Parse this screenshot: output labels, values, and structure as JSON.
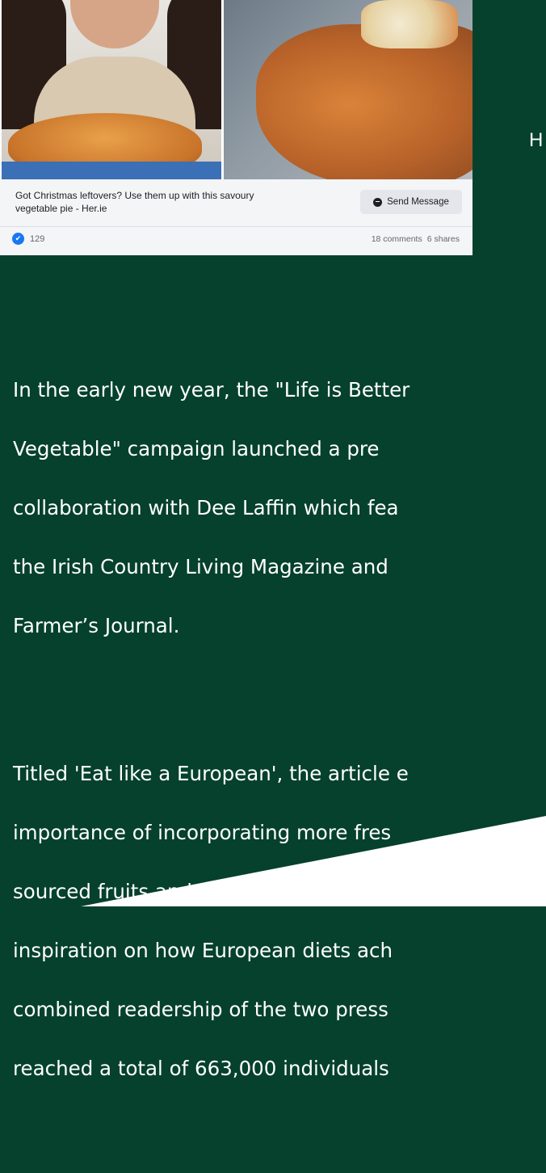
{
  "fb_post": {
    "headline_line1": "Got Christmas leftovers? Use them up with this savoury",
    "headline_line2": "vegetable pie - Her.ie",
    "send_button_label": "Send Message",
    "like_count": "129",
    "comments": "18 comments",
    "shares": "6 shares",
    "like_icon": "like-thumb-icon"
  },
  "side_text": "H",
  "article": {
    "paragraph1": [
      "In the early new year, the \"Life is Better",
      "Vegetable\" campaign launched a pre",
      "collaboration with Dee Laffin which fea",
      "the Irish Country Living Magazine and",
      "Farmer’s Journal."
    ],
    "paragraph2": [
      "Titled 'Eat like a European', the article e",
      "importance of incorporating more fres",
      "sourced fruits and vegetables into die",
      "inspiration on how European diets ach",
      "combined readership of the two press",
      "reached a total of 663,000 individuals"
    ]
  },
  "colors": {
    "background": "#05412c",
    "bottom_shape": "#ffffff",
    "text": "#ffffff",
    "fb_like_blue": "#1877f2"
  }
}
